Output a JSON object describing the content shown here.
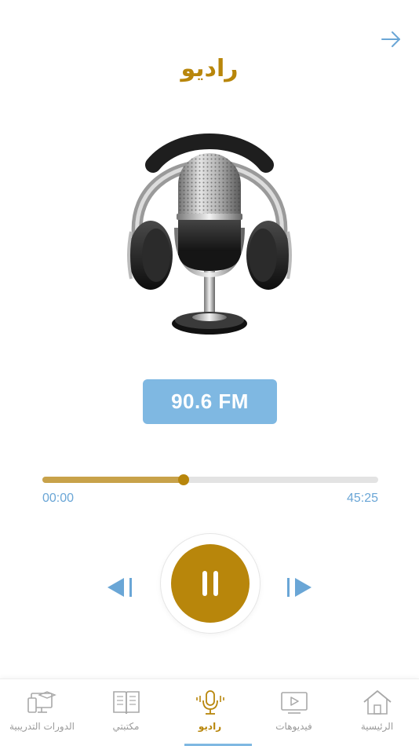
{
  "header": {
    "title": "راديو",
    "back_icon": "arrow-right-icon"
  },
  "station": {
    "frequency": "90.6 FM"
  },
  "player": {
    "elapsed": "00:00",
    "duration": "45:25",
    "progress": 0.42,
    "play_icon": "pause-icon",
    "prev_icon": "skip-previous-icon",
    "next_icon": "skip-next-icon"
  },
  "colors": {
    "accent": "#b8860b",
    "blue": "#7fb8e2",
    "track": "#e3e3e3"
  },
  "tabs": [
    {
      "label": "الرئيسية",
      "icon": "home-icon",
      "active": false
    },
    {
      "label": "فيديوهات",
      "icon": "video-icon",
      "active": false
    },
    {
      "label": "راديو",
      "icon": "microphone-icon",
      "active": true
    },
    {
      "label": "مكتبتي",
      "icon": "book-icon",
      "active": false
    },
    {
      "label": "الدورات التدريبية",
      "icon": "courses-icon",
      "active": false
    }
  ]
}
